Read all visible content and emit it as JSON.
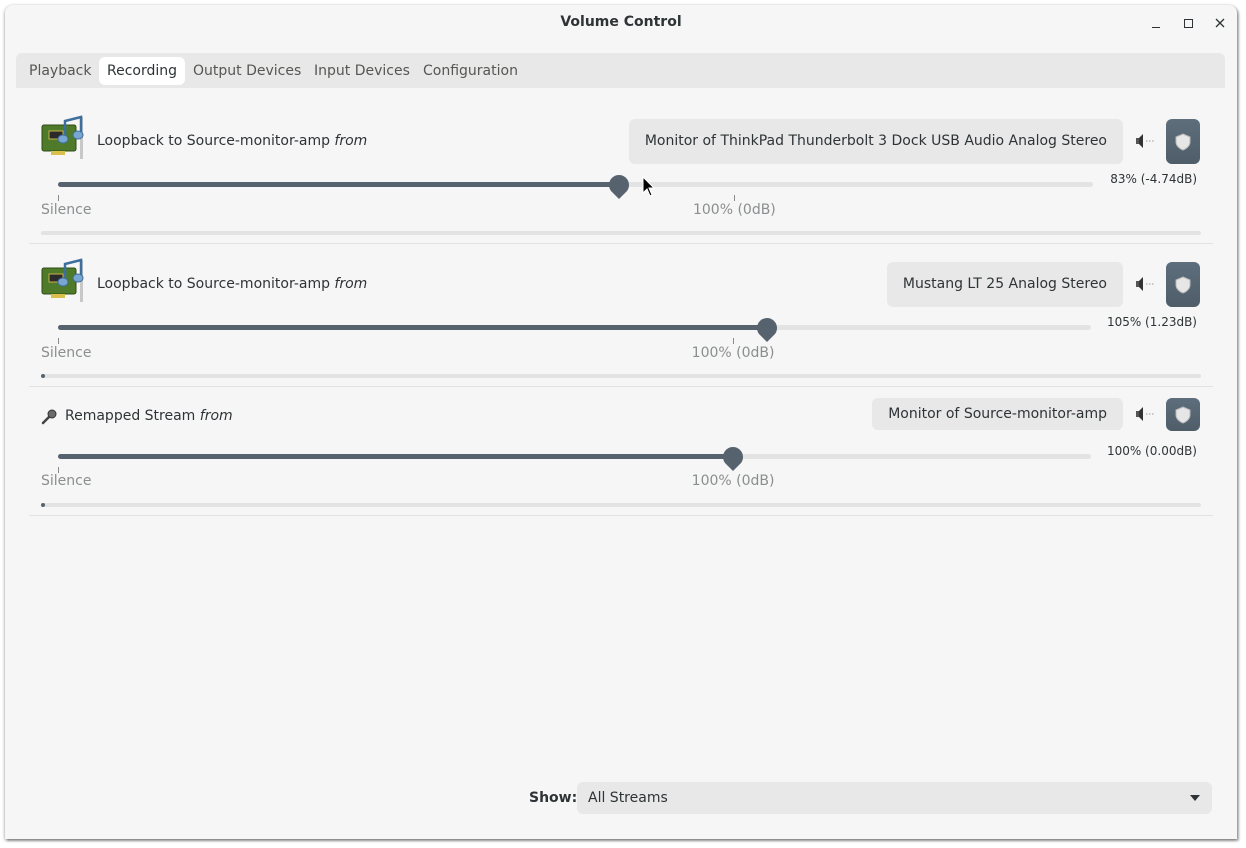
{
  "window": {
    "title": "Volume Control",
    "controls": {
      "minimize": "minimize",
      "maximize": "maximize",
      "close": "close"
    }
  },
  "tabs": [
    {
      "label": "Playback",
      "active": false
    },
    {
      "label": "Recording",
      "active": true
    },
    {
      "label": "Output Devices",
      "active": false
    },
    {
      "label": "Input Devices",
      "active": false
    },
    {
      "label": "Configuration",
      "active": false
    }
  ],
  "slider_scale": {
    "silence_label": "Silence",
    "norm_label": "100% (0dB)",
    "norm_percent": 100,
    "max_percent": 153
  },
  "streams": [
    {
      "icon": "sound-card-music-icon",
      "name": "Loopback to Source-monitor-amp",
      "from_label": "from",
      "device": "Monitor of ThinkPad Thunderbolt 3 Dock USB Audio Analog Stereo",
      "volume_percent": 83,
      "volume_readout": "83% (-4.74dB)",
      "peak_level": 0,
      "muted": false,
      "channels_locked": true
    },
    {
      "icon": "sound-card-music-icon",
      "name": "Loopback to Source-monitor-amp",
      "from_label": "from",
      "device": "Mustang LT 25 Analog Stereo",
      "volume_percent": 105,
      "volume_readout": "105% (1.23dB)",
      "peak_level": 0.003,
      "muted": false,
      "channels_locked": true
    },
    {
      "icon": "microphone-icon",
      "name": "Remapped Stream",
      "from_label": "from",
      "device": "Monitor of Source-monitor-amp",
      "volume_percent": 100,
      "volume_readout": "100% (0.00dB)",
      "peak_level": 0.003,
      "muted": false,
      "channels_locked": true
    }
  ],
  "footer": {
    "show_label": "Show:",
    "show_value": "All Streams"
  },
  "colors": {
    "accent": "#56636e",
    "window_bg": "#f6f6f6",
    "button_bg": "#e8e8e8",
    "lock_button": "#56636e"
  }
}
